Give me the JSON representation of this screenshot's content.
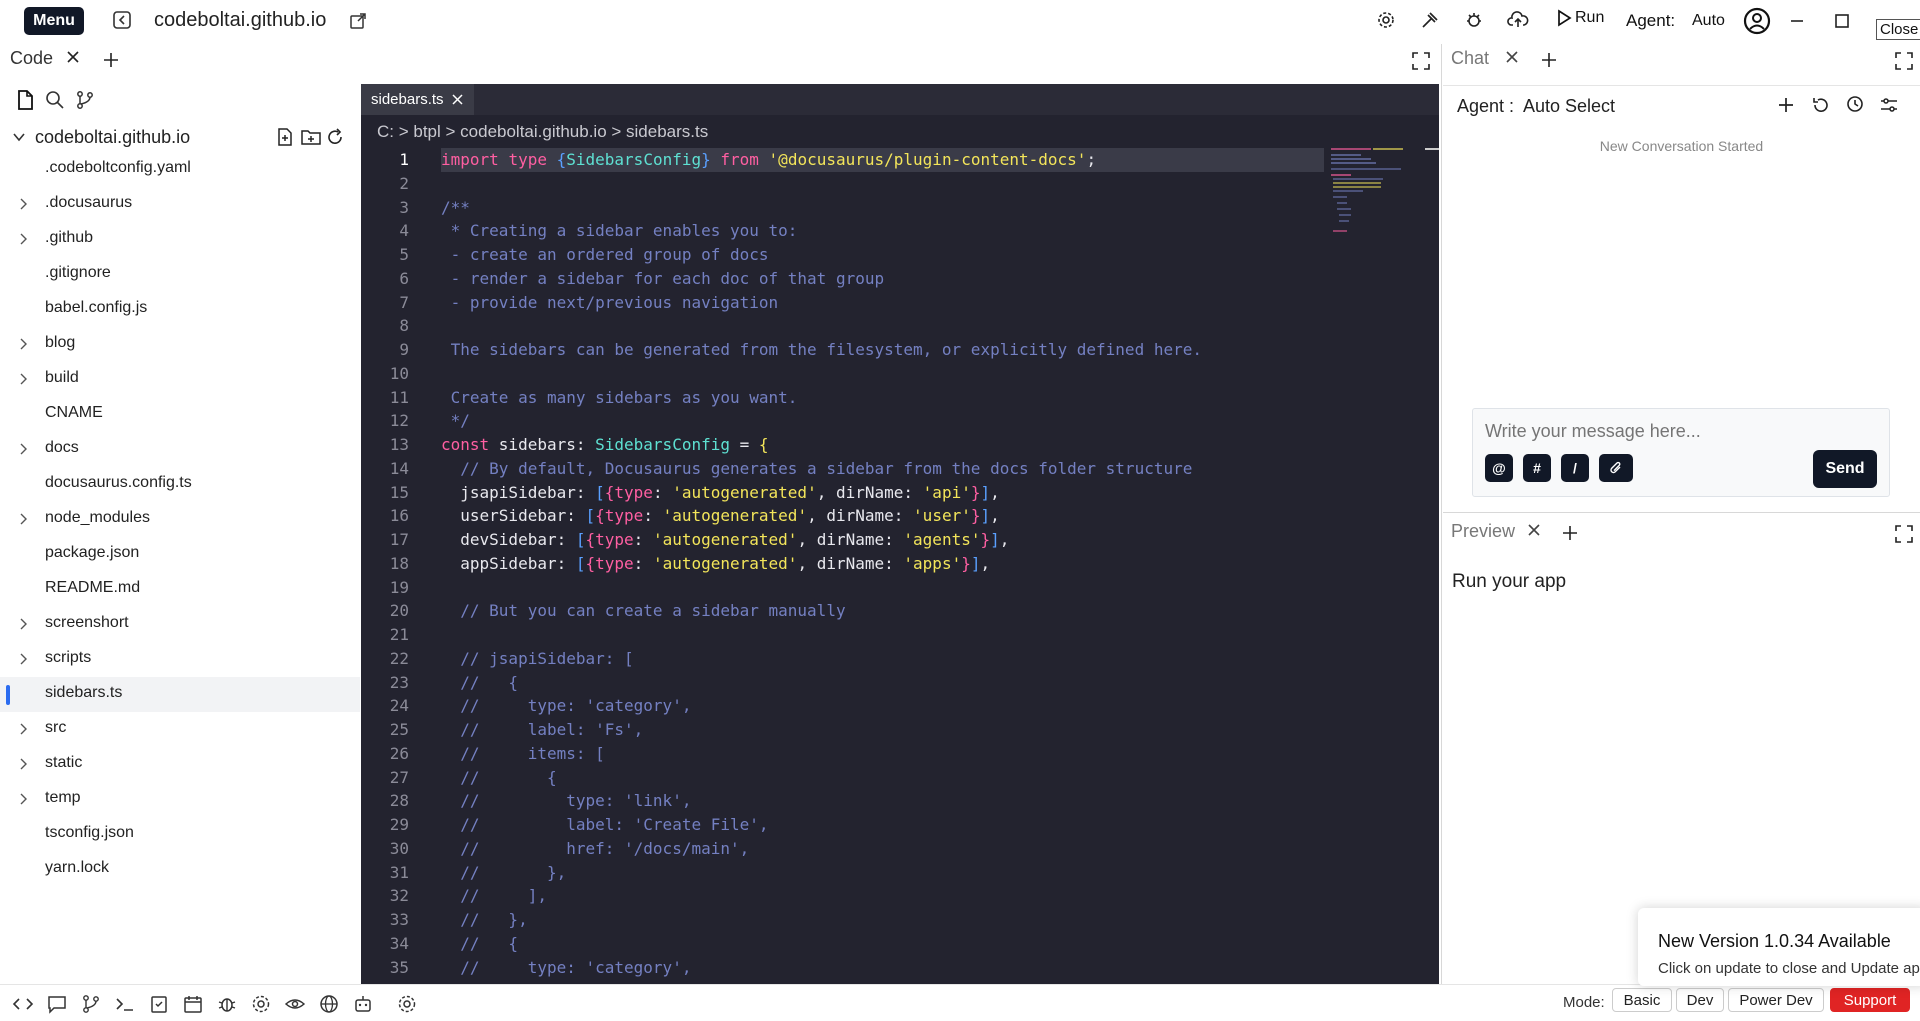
{
  "topbar": {
    "menu_label": "Menu",
    "title": "codeboltai.github.io",
    "run_label": "Run",
    "agent_label": "Agent:",
    "agent_value": "Auto",
    "close_tooltip": "Close"
  },
  "left_panel": {
    "tab_label": "Code",
    "root_folder": "codeboltai.github.io",
    "files": [
      {
        "name": ".codeboltconfig.yaml",
        "folder": false
      },
      {
        "name": ".docusaurus",
        "folder": true
      },
      {
        "name": ".github",
        "folder": true
      },
      {
        "name": ".gitignore",
        "folder": false
      },
      {
        "name": "babel.config.js",
        "folder": false
      },
      {
        "name": "blog",
        "folder": true
      },
      {
        "name": "build",
        "folder": true
      },
      {
        "name": "CNAME",
        "folder": false
      },
      {
        "name": "docs",
        "folder": true
      },
      {
        "name": "docusaurus.config.ts",
        "folder": false
      },
      {
        "name": "node_modules",
        "folder": true
      },
      {
        "name": "package.json",
        "folder": false
      },
      {
        "name": "README.md",
        "folder": false
      },
      {
        "name": "screenshort",
        "folder": true
      },
      {
        "name": "scripts",
        "folder": true
      },
      {
        "name": "sidebars.ts",
        "folder": false,
        "active": true
      },
      {
        "name": "src",
        "folder": true
      },
      {
        "name": "static",
        "folder": true
      },
      {
        "name": "temp",
        "folder": true
      },
      {
        "name": "tsconfig.json",
        "folder": false
      },
      {
        "name": "yarn.lock",
        "folder": false
      }
    ]
  },
  "editor": {
    "tab_label": "sidebars.ts",
    "breadcrumb": "C: > btpl > codeboltai.github.io > sidebars.ts",
    "current_line": 1,
    "lines": [
      [
        [
          "k",
          "import "
        ],
        [
          "k",
          "type "
        ],
        [
          "p",
          "{"
        ],
        [
          "ty",
          "SidebarsConfig"
        ],
        [
          "p",
          "}"
        ],
        [
          "k",
          " from "
        ],
        [
          "s",
          "'@docusaurus/plugin-content-docs'"
        ],
        [
          "v",
          ";"
        ]
      ],
      [],
      [
        [
          "c",
          "/**"
        ]
      ],
      [
        [
          "c",
          " * Creating a sidebar enables you to:"
        ]
      ],
      [
        [
          "c",
          " - create an ordered group of docs"
        ]
      ],
      [
        [
          "c",
          " - render a sidebar for each doc of that group"
        ]
      ],
      [
        [
          "c",
          " - provide next/previous navigation"
        ]
      ],
      [],
      [
        [
          "c",
          " The sidebars can be generated from the filesystem, or explicitly defined here."
        ]
      ],
      [],
      [
        [
          "c",
          " Create as many sidebars as you want."
        ]
      ],
      [
        [
          "c",
          " */"
        ]
      ],
      [
        [
          "k",
          "const "
        ],
        [
          "v",
          "sidebars"
        ],
        [
          "v",
          ": "
        ],
        [
          "ty",
          "SidebarsConfig"
        ],
        [
          "op",
          " = "
        ],
        [
          "s",
          "{"
        ]
      ],
      [
        [
          "c",
          "  // By default, Docusaurus generates a sidebar from the docs folder structure"
        ]
      ],
      [
        [
          "v",
          "  jsapiSidebar: "
        ],
        [
          "p",
          "["
        ],
        [
          "k",
          "{"
        ],
        [
          "k",
          "type"
        ],
        [
          "v",
          ": "
        ],
        [
          "s",
          "'autogenerated'"
        ],
        [
          "v",
          ", dirName: "
        ],
        [
          "s",
          "'api'"
        ],
        [
          "k",
          "}"
        ],
        [
          "p",
          "]"
        ],
        [
          "v",
          ","
        ]
      ],
      [
        [
          "v",
          "  userSidebar: "
        ],
        [
          "p",
          "["
        ],
        [
          "k",
          "{"
        ],
        [
          "k",
          "type"
        ],
        [
          "v",
          ": "
        ],
        [
          "s",
          "'autogenerated'"
        ],
        [
          "v",
          ", dirName: "
        ],
        [
          "s",
          "'user'"
        ],
        [
          "k",
          "}"
        ],
        [
          "p",
          "]"
        ],
        [
          "v",
          ","
        ]
      ],
      [
        [
          "v",
          "  devSidebar: "
        ],
        [
          "p",
          "["
        ],
        [
          "k",
          "{"
        ],
        [
          "k",
          "type"
        ],
        [
          "v",
          ": "
        ],
        [
          "s",
          "'autogenerated'"
        ],
        [
          "v",
          ", dirName: "
        ],
        [
          "s",
          "'agents'"
        ],
        [
          "k",
          "}"
        ],
        [
          "p",
          "]"
        ],
        [
          "v",
          ","
        ]
      ],
      [
        [
          "v",
          "  appSidebar: "
        ],
        [
          "p",
          "["
        ],
        [
          "k",
          "{"
        ],
        [
          "k",
          "type"
        ],
        [
          "v",
          ": "
        ],
        [
          "s",
          "'autogenerated'"
        ],
        [
          "v",
          ", dirName: "
        ],
        [
          "s",
          "'apps'"
        ],
        [
          "k",
          "}"
        ],
        [
          "p",
          "]"
        ],
        [
          "v",
          ","
        ]
      ],
      [],
      [
        [
          "c",
          "  // But you can create a sidebar manually"
        ]
      ],
      [],
      [
        [
          "c",
          "  // jsapiSidebar: ["
        ]
      ],
      [
        [
          "c",
          "  //   {"
        ]
      ],
      [
        [
          "c",
          "  //     type: 'category',"
        ]
      ],
      [
        [
          "c",
          "  //     label: 'Fs',"
        ]
      ],
      [
        [
          "c",
          "  //     items: ["
        ]
      ],
      [
        [
          "c",
          "  //       {"
        ]
      ],
      [
        [
          "c",
          "  //         type: 'link',"
        ]
      ],
      [
        [
          "c",
          "  //         label: 'Create File',"
        ]
      ],
      [
        [
          "c",
          "  //         href: '/docs/main',"
        ]
      ],
      [
        [
          "c",
          "  //       },"
        ]
      ],
      [
        [
          "c",
          "  //     ],"
        ]
      ],
      [
        [
          "c",
          "  //   },"
        ]
      ],
      [
        [
          "c",
          "  //   {"
        ]
      ],
      [
        [
          "c",
          "  //     type: 'category',"
        ]
      ]
    ]
  },
  "chat": {
    "tab_label": "Chat",
    "agent_label": "Agent :",
    "agent_value": "Auto Select",
    "status": "New Conversation Started",
    "placeholder": "Write your message here...",
    "chips": [
      "@",
      "#",
      "/"
    ],
    "send_label": "Send"
  },
  "preview": {
    "tab_label": "Preview",
    "body_text": "Run your app"
  },
  "toast": {
    "title": "New Version 1.0.34 Available",
    "body": "Click on update to close and Update app"
  },
  "bottombar": {
    "mode_label": "Mode:",
    "modes": [
      "Basic",
      "Dev",
      "Power Dev",
      "Support"
    ]
  },
  "colors": {
    "editor_bg": "#23232f",
    "keyword": "#ff5fa2",
    "type": "#5ee0d2",
    "string": "#f3e55a",
    "comment": "#7480c2",
    "dark_button": "#111827",
    "active_indicator": "#2b6cf0",
    "support_button": "#e02424"
  }
}
